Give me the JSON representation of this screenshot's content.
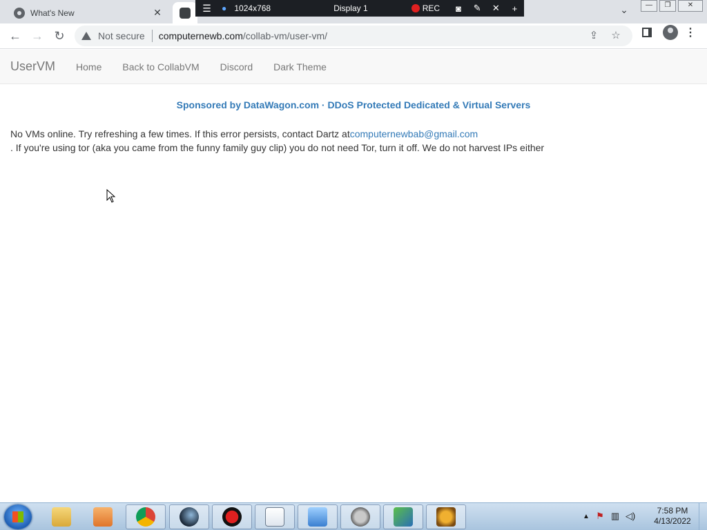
{
  "browser": {
    "tab_title": "What's New",
    "tab_close": "✕",
    "tab_list_chevron": "⌄",
    "url_security": "Not secure",
    "url_host": "computernewb.com",
    "url_path": "/collab-vm/user-vm/"
  },
  "remote_toolbar": {
    "resolution": "1024x768",
    "display": "Display 1",
    "rec": "REC"
  },
  "page": {
    "brand": "UserVM",
    "nav": [
      "Home",
      "Back to CollabVM",
      "Discord",
      "Dark Theme"
    ],
    "sponsor": "Sponsored by DataWagon.com · DDoS Protected Dedicated & Virtual Servers",
    "message_before": "No VMs online. Try refreshing a few times. If this error persists, contact Dartz at",
    "message_email": "computernewbab@gmail.com",
    "message_after": ". If you're using tor (aka you came from the funny family guy clip) you do not need Tor, turn it off. We do not harvest IPs either"
  },
  "taskbar": {
    "items": [
      "windows-explorer",
      "media-player",
      "chrome",
      "steam",
      "recorder",
      "notepad",
      "control-panel",
      "movie-maker",
      "display-settings",
      "game"
    ],
    "time": "7:58 PM",
    "date": "4/13/2022"
  },
  "icons": {
    "back": "←",
    "forward": "→",
    "reload": "↻",
    "share": "⇪",
    "star": "☆",
    "kebab": "⋮",
    "menu": "☰",
    "pin": "📌",
    "camera": "📷",
    "pencil": "✎",
    "close": "✕",
    "plus": "+",
    "tray_up": "▲",
    "tray_flag": "⚑",
    "tray_net": "▥",
    "tray_vol": "🔊"
  },
  "colors": {
    "link": "#337ab7",
    "navbar_bg": "#f8f8f8",
    "rec_red": "#e02020"
  }
}
